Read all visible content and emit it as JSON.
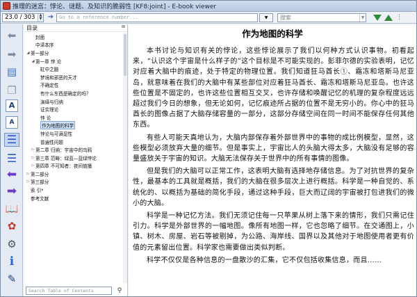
{
  "window": {
    "title": "推理的迷宫：悖论、谜题、及知识的脆弱性 [KF8:joint] - E-book viewer"
  },
  "toolbar": {
    "position_value": "23.0 / 303",
    "reference_placeholder": "Go to a reference number...",
    "search_placeholder": "搜索"
  },
  "toc": {
    "header": "目录",
    "search_placeholder": "Search Table of Contents",
    "items": [
      {
        "label": "封面",
        "level": 1,
        "arrow": ""
      },
      {
        "label": "中译本序",
        "level": 1,
        "arrow": ""
      },
      {
        "label": "第一部分",
        "level": 0,
        "arrow": "◢"
      },
      {
        "label": "第一章 悖 论",
        "level": 1,
        "arrow": "◢"
      },
      {
        "label": "缸中之脑",
        "level": 2,
        "arrow": ""
      },
      {
        "label": "梦境和邪恶的天才",
        "level": 2,
        "arrow": ""
      },
      {
        "label": "不确定性",
        "level": 2,
        "arrow": ""
      },
      {
        "label": "有什么东西是确定的吗？",
        "level": 2,
        "arrow": ""
      },
      {
        "label": "演绎与归纳",
        "level": 2,
        "arrow": ""
      },
      {
        "label": "证实理论",
        "level": 2,
        "arrow": ""
      },
      {
        "label": "悖 论",
        "level": 2,
        "arrow": ""
      },
      {
        "label": "作为地图的科学",
        "level": 2,
        "arrow": "",
        "selected": true
      },
      {
        "label": "悖论与可满足性",
        "level": 2,
        "arrow": ""
      },
      {
        "label": "普遍性问题",
        "level": 2,
        "arrow": ""
      },
      {
        "label": "第二章 归纳：宇宙中的乌鸦",
        "level": 1,
        "arrow": "▷"
      },
      {
        "label": "第三章 范畴：绿蓝—蓝绿悖论",
        "level": 1,
        "arrow": "▷"
      },
      {
        "label": "第四章 不可知者：夜间值播",
        "level": 1,
        "arrow": "▷"
      },
      {
        "label": "第二部分",
        "level": 0,
        "arrow": "▷"
      },
      {
        "label": "第三部分",
        "level": 0,
        "arrow": "▷"
      },
      {
        "label": "索 引*",
        "level": 0,
        "arrow": ""
      },
      {
        "label": "参考文献",
        "level": 0,
        "arrow": ""
      }
    ]
  },
  "content": {
    "chapter_title": "作为地图的科学",
    "paragraphs": [
      "本书讨论与知识有关的悖论，这些悖论展示了我们以何种方式认识事物。初看起来，“认识这个宇宙是什么样子的”这个目标是不可能实现的。彭菲尔德的实验表明，记忆对应着大脑中的痕迹，处于特定的物理位置。我们知道狂马酋长①、霜冻和塔斯马尼亚岛，就意味着在我们的大脑中有某些部位对应着狂马酋长、霜冻和塔斯马尼亚岛。也许这些位置是不固定的，也许这些位置相互交叉，也许存储和唤醒记忆的机理的复杂程度远远超过我们今日的想象，但无论如何，记忆痕迹所占据的位置不是无穷小的。你心中的狂马酋长的图像占据了大脑存储容量的一部分，这部分存储空间在同一时间不能保存任何其他东西。",
      "有些人可能天真地认为，大脑内部保存着外部世界中的事物的成比例模型，显然，这些模型必须放弃大量的细节。但是事实上，宇宙比人的头脑大得太多，大脑没有足够的容量盛放关于宇宙的知识。大脑无法保存关于世界中的所有事情的图像。",
      "但是我们的大脑可以正常工作，这表明大脑有选择地存储信息。为了对抗世界的复杂性，最基本的工具就是概括，我们的大脑在很多层次上进行概括。科学是一种自觉的、系统化的、以概括为基础的简化手段，通过这种手段，巨大而辽阔的宇宙被打包进我们的微小的大脑。",
      "科学是一种记忆方法。我们无须记住每一只苹果从树上落下来的情形，我们只需记住引力。科学是外部世界的一幅地图。像所有地图一样，它也忽略了细节。在交通图上，小镇、树木、房屋、岩石等被剔掉，为公路、海岸线、国界以及其他对于地图使用者更有价值的元素留出位置。科学家也需要做出类似判断。",
      "科学不仅仅是各种信息的一盘散沙的汇集，它不仅包括收集信息，而且……"
    ]
  }
}
